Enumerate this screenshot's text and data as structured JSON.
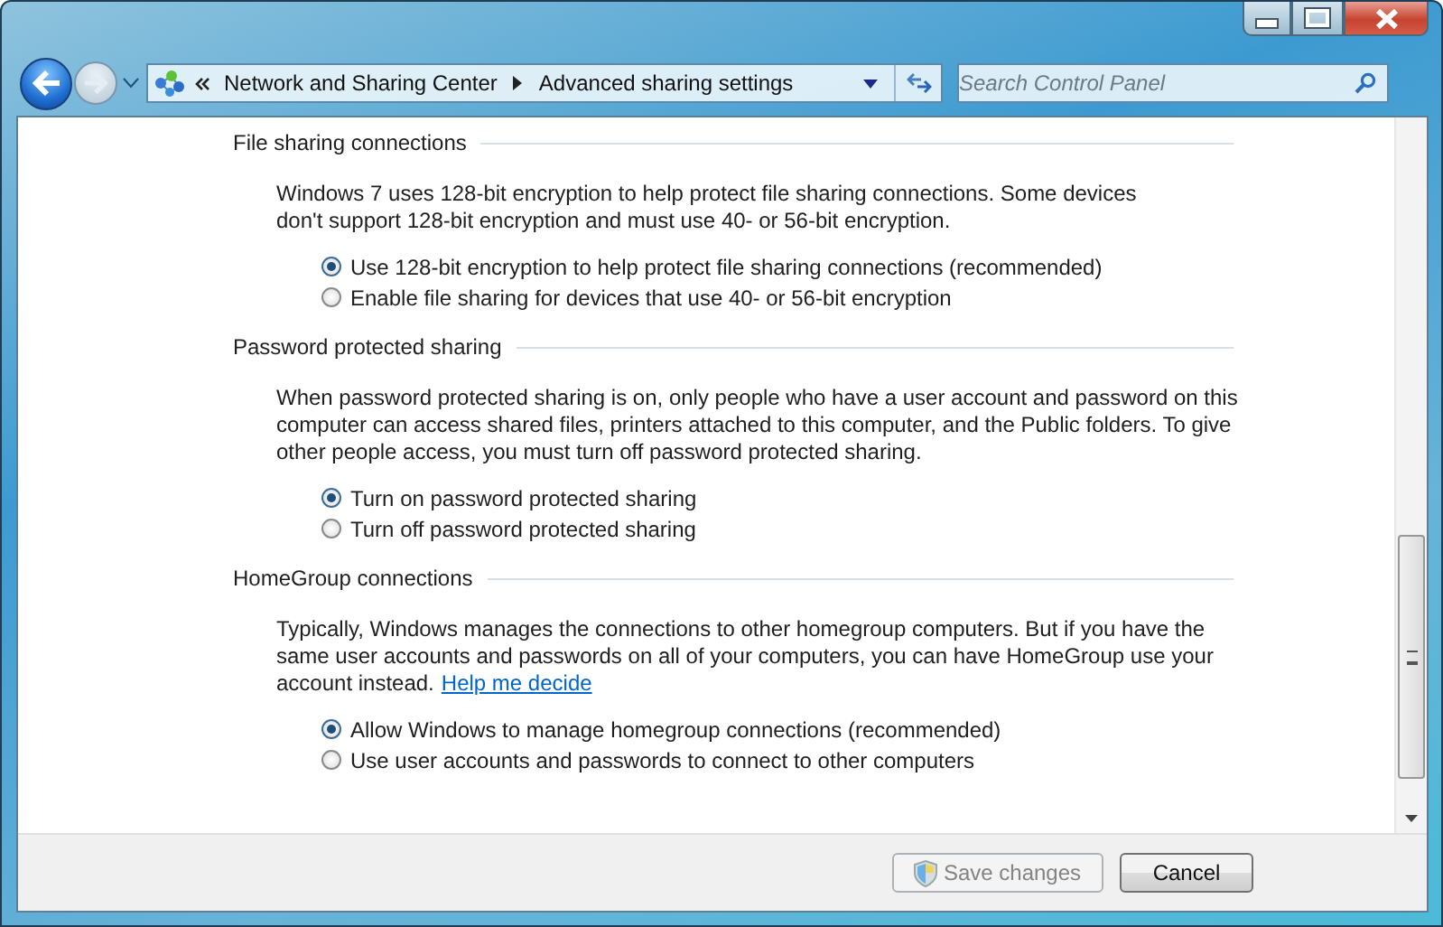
{
  "address_bar": {
    "breadcrumbs": [
      "Network and Sharing Center",
      "Advanced sharing settings"
    ]
  },
  "search": {
    "placeholder": "Search Control Panel"
  },
  "sections": [
    {
      "heading": "File sharing connections",
      "description": "Windows 7 uses 128-bit encryption to help protect file sharing connections. Some devices don't support 128-bit encryption and must use 40- or 56-bit encryption.",
      "options": [
        {
          "label": "Use 128-bit encryption to help protect file sharing connections (recommended)",
          "selected": true
        },
        {
          "label": "Enable file sharing for devices that use 40- or 56-bit encryption",
          "selected": false
        }
      ]
    },
    {
      "heading": "Password protected sharing",
      "description": "When password protected sharing is on, only people who have a user account and password on this computer can access shared files, printers attached to this computer, and the Public folders. To give other people access, you must turn off password protected sharing.",
      "options": [
        {
          "label": "Turn on password protected sharing",
          "selected": true
        },
        {
          "label": "Turn off password protected sharing",
          "selected": false
        }
      ]
    },
    {
      "heading": "HomeGroup connections",
      "description": "Typically, Windows manages the connections to other homegroup computers. But if you have the same user accounts and passwords on all of your computers, you can have HomeGroup use your account instead.",
      "link": "Help me decide",
      "options": [
        {
          "label": "Allow Windows to manage homegroup connections (recommended)",
          "selected": true
        },
        {
          "label": "Use user accounts and passwords to connect to other computers",
          "selected": false
        }
      ]
    }
  ],
  "buttons": [
    {
      "label": "Save changes",
      "disabled": true,
      "shield": true
    },
    {
      "label": "Cancel",
      "disabled": false,
      "shield": false
    }
  ]
}
